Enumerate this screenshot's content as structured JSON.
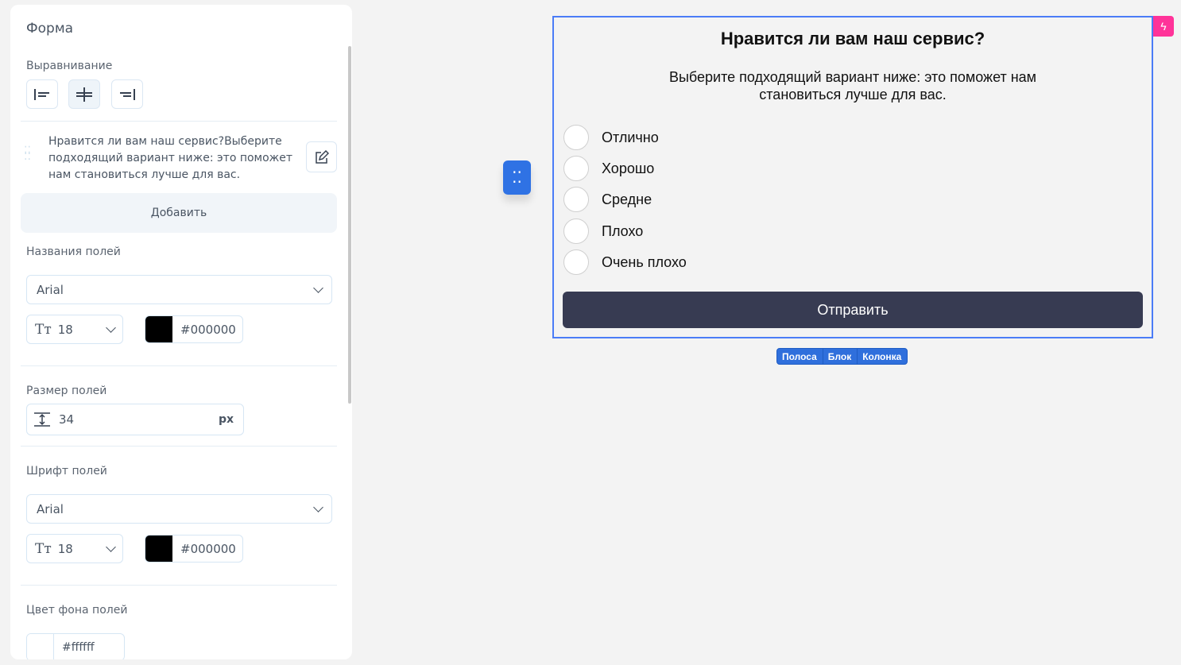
{
  "panel": {
    "title": "Форма",
    "alignment_label": "Выравнивание",
    "align_buttons": [
      "align-left",
      "align-center",
      "align-right"
    ],
    "item_text": "Нравится ли вам наш сервис?Выберите подходящий вариант ниже: это поможет нам становиться лучше для вас.",
    "add_label": "Добавить",
    "field_names_label": "Названия полей",
    "field_names_font": "Arial",
    "field_names_size": "18",
    "field_names_color": "#000000",
    "field_size_label": "Размер полей",
    "field_size_value": "34",
    "field_size_unit": "px",
    "field_font_label": "Шрифт полей",
    "field_font": "Arial",
    "field_font_size": "18",
    "field_font_color": "#000000",
    "field_bg_label": "Цвет фона полей",
    "field_bg_color": "#ffffff"
  },
  "form": {
    "title": "Нравится ли вам наш сервис?",
    "subtitle_line1": "Выберите подходящий вариант ниже: это поможет нам",
    "subtitle_line2": "становиться лучше для вас.",
    "options": [
      "Отлично",
      "Хорошо",
      "Средне",
      "Плохо",
      "Очень плохо"
    ],
    "submit": "Отправить"
  },
  "breadcrumbs": [
    "Полоса",
    "Блок",
    "Колонка"
  ],
  "colors": {
    "accent": "#4a7cf7",
    "submit_bg": "#373b52",
    "badge": "#ff3399"
  }
}
